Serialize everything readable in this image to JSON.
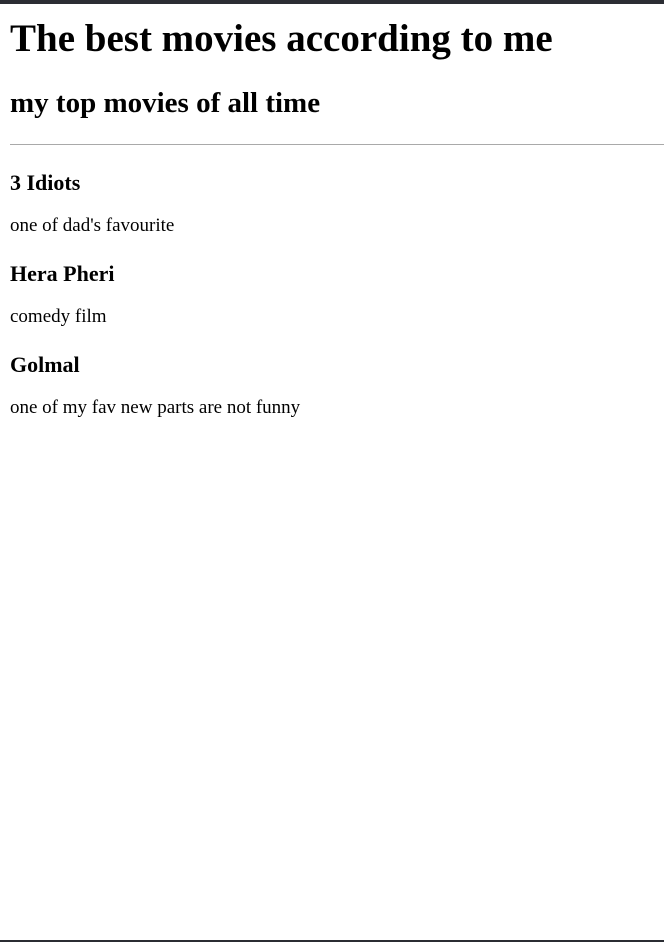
{
  "header": {
    "title": "The best movies according to me",
    "subtitle": "my top movies of all time"
  },
  "movies": [
    {
      "title": "3 Idiots",
      "description": "one of dad's favourite"
    },
    {
      "title": "Hera Pheri",
      "description": "comedy film"
    },
    {
      "title": "Golmal",
      "description": "one of my fav new parts are not funny"
    }
  ],
  "colors": {
    "frame": "#2b2d33",
    "divider": "#a9a9a9",
    "text": "#000000",
    "background": "#ffffff"
  }
}
